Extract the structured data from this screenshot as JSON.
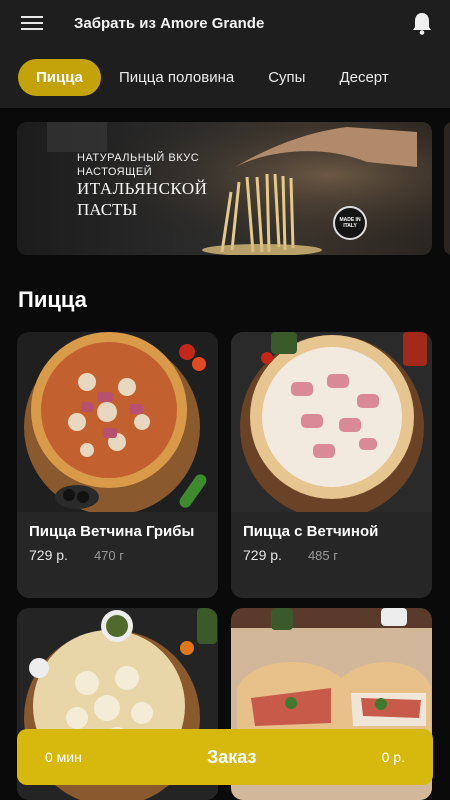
{
  "header": {
    "title": "Забрать из Amore Grande",
    "menu_icon": "hamburger-icon",
    "notification_icon": "bell-icon"
  },
  "tabs": [
    {
      "label": "Пицца",
      "active": true
    },
    {
      "label": "Пицца половина",
      "active": false
    },
    {
      "label": "Супы",
      "active": false
    },
    {
      "label": "Десерт",
      "active": false
    }
  ],
  "banner": {
    "line1": "НАТУРАЛЬНЫЙ ВКУС",
    "line2": "НАСТОЯЩЕЙ",
    "line3": "ИТАЛЬЯНСКОЙ",
    "line4": "ПАСТЫ",
    "badge_top": "MADE IN",
    "badge_bottom": "ITALY"
  },
  "section": {
    "title": "Пицца"
  },
  "products": [
    {
      "name": "Пицца Ветчина Грибы",
      "price": "729 р.",
      "weight": "470 г"
    },
    {
      "name": "Пицца с Ветчиной",
      "price": "729 р.",
      "weight": "485 г"
    }
  ],
  "order": {
    "time": "0 мин",
    "label": "Заказ",
    "sum": "0 р."
  },
  "colors": {
    "accent": "#c4a20a",
    "order_bar": "#d7b90e",
    "header_bg": "#1e1e1e",
    "card_bg": "#262626"
  }
}
